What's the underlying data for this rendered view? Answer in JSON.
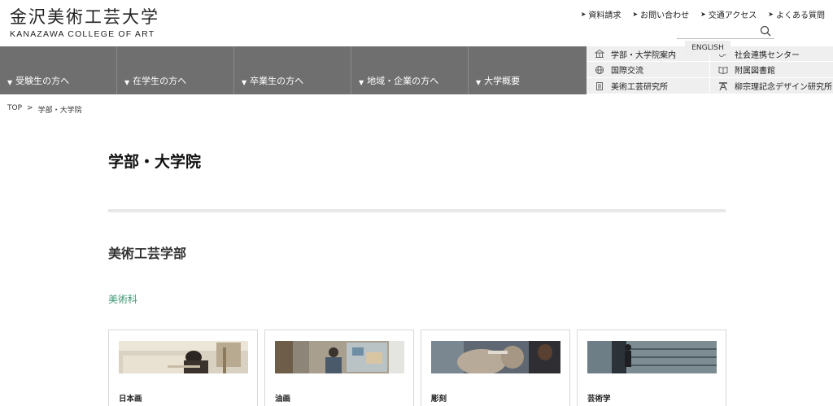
{
  "header": {
    "logo_jp": "金沢美術工芸大学",
    "logo_en": "KANAZAWA COLLEGE OF ART"
  },
  "util_links": [
    {
      "label": "資料請求"
    },
    {
      "label": "お問い合わせ"
    },
    {
      "label": "交通アクセス"
    },
    {
      "label": "よくある質問"
    }
  ],
  "search": {
    "placeholder": "",
    "value": ""
  },
  "english": "ENGLISH",
  "main_nav": [
    {
      "label": "受験生の方へ"
    },
    {
      "label": "在学生の方へ"
    },
    {
      "label": "卒業生の方へ"
    },
    {
      "label": "地域・企業の方へ"
    },
    {
      "label": "大学概要"
    }
  ],
  "sub_nav": [
    {
      "label": "学部・大学院案内",
      "icon": "building-icon"
    },
    {
      "label": "社会連携センター",
      "icon": "link-icon"
    },
    {
      "label": "国際交流",
      "icon": "globe-icon"
    },
    {
      "label": "附属図書館",
      "icon": "book-icon"
    },
    {
      "label": "美術工芸研究所",
      "icon": "document-icon"
    },
    {
      "label": "柳宗理記念デザイン研究所",
      "icon": "easel-icon"
    }
  ],
  "breadcrumb": {
    "home": "TOP",
    "separator": ">",
    "current": "学部・大学院"
  },
  "page_title": "学部・大学院",
  "section_title": "美術工芸学部",
  "department": {
    "label": "美術科",
    "color": "#3f9a74"
  },
  "cards": [
    {
      "label": "日本画",
      "image": "japanese-painting-photo"
    },
    {
      "label": "油画",
      "image": "oil-painting-photo"
    },
    {
      "label": "彫刻",
      "image": "sculpture-photo"
    },
    {
      "label": "芸術学",
      "image": "art-studies-photo"
    }
  ],
  "colors": {
    "nav_bg": "#6f6f6f",
    "subnav_bg": "#efefef",
    "accent_green": "#3f9a74"
  }
}
